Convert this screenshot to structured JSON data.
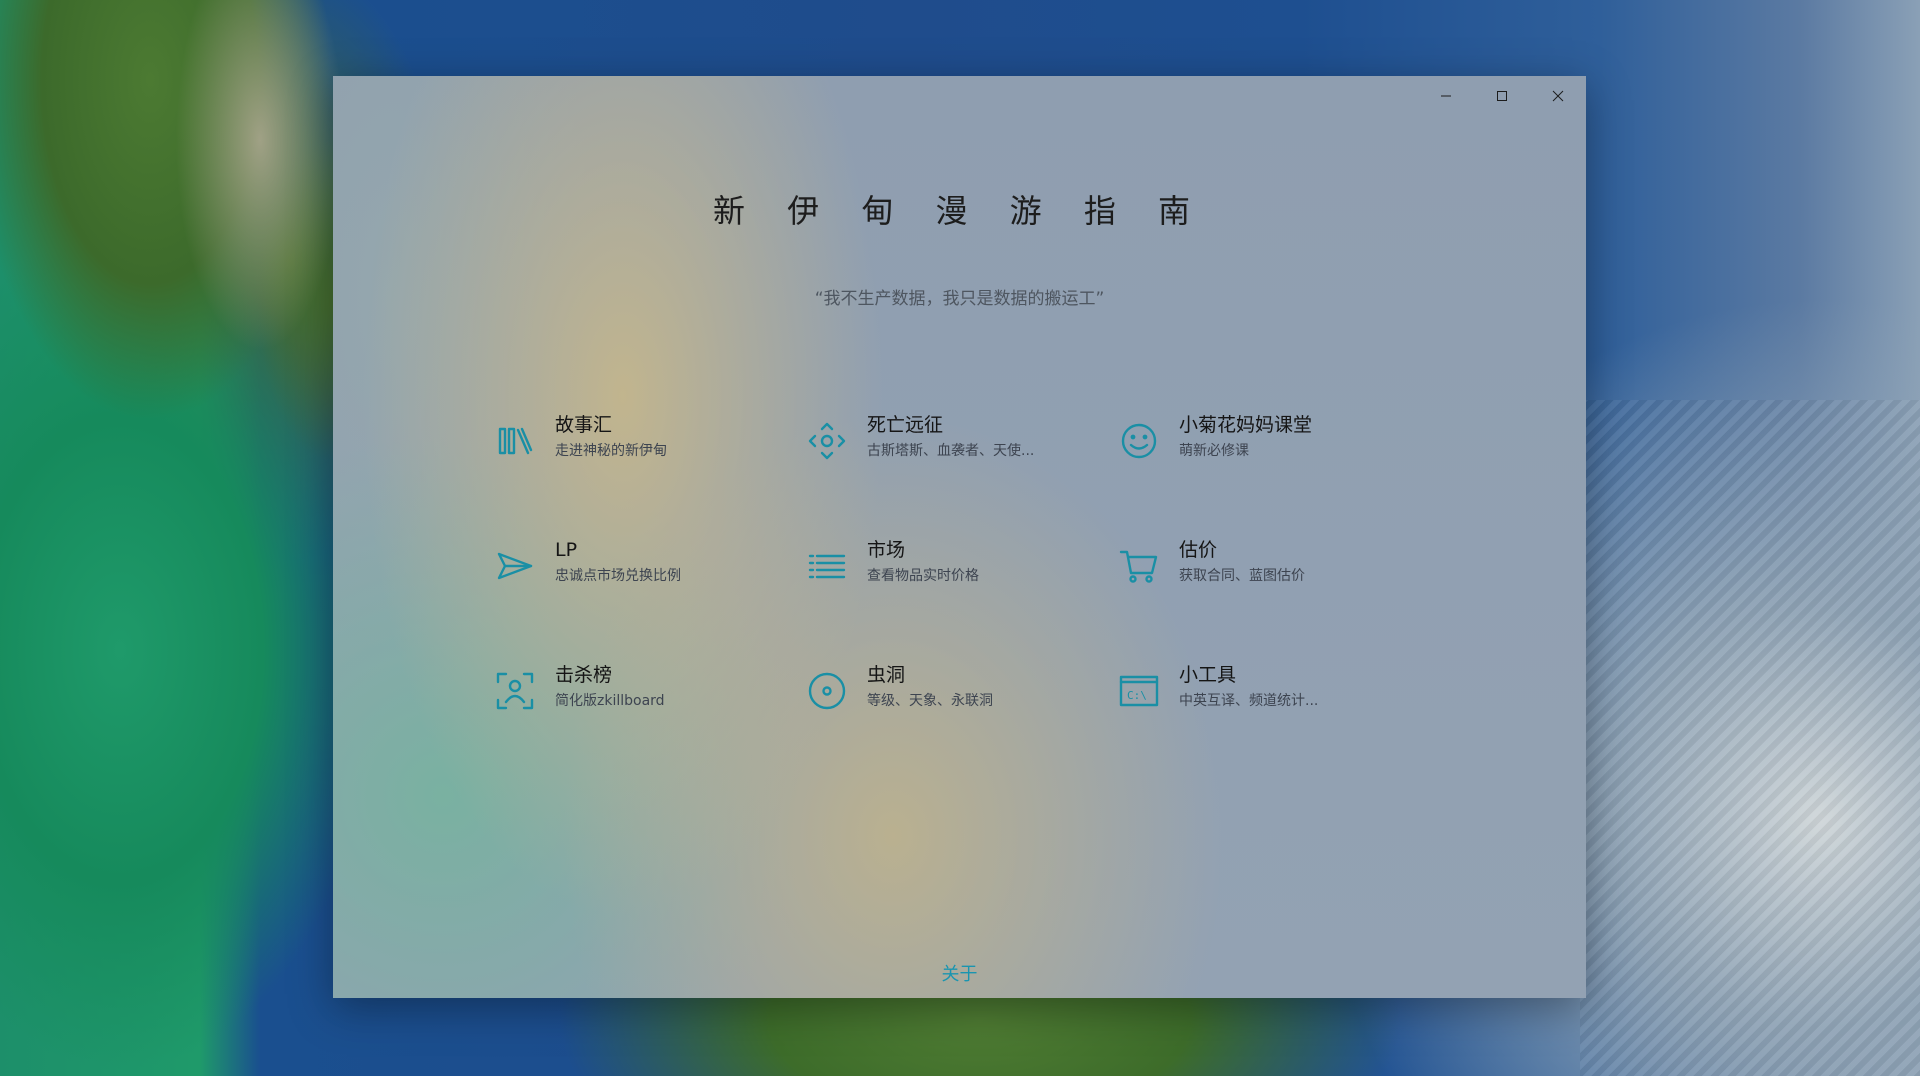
{
  "window": {
    "controls": {
      "minimize_icon": "minimize-icon",
      "maximize_icon": "maximize-icon",
      "close_icon": "close-icon"
    }
  },
  "header": {
    "title": "新 伊 甸 漫 游 指 南",
    "subtitle": "“我不生产数据，我只是数据的搬运工”"
  },
  "tiles": [
    {
      "icon": "library-icon",
      "title": "故事汇",
      "subtitle": "走进神秘的新伊甸"
    },
    {
      "icon": "move-arrows-icon",
      "title": "死亡远征",
      "subtitle": "古斯塔斯、血袭者、天使..."
    },
    {
      "icon": "smiley-icon",
      "title": "小菊花妈妈课堂",
      "subtitle": "萌新必修课"
    },
    {
      "icon": "send-icon",
      "title": "LP",
      "subtitle": "忠诚点市场兑换比例"
    },
    {
      "icon": "list-icon",
      "title": "市场",
      "subtitle": "查看物品实时价格"
    },
    {
      "icon": "cart-icon",
      "title": "估价",
      "subtitle": "获取合同、蓝图估价"
    },
    {
      "icon": "contact-scan-icon",
      "title": "击杀榜",
      "subtitle": "简化版zkillboard"
    },
    {
      "icon": "target-icon",
      "title": "虫洞",
      "subtitle": "等级、天象、永联洞"
    },
    {
      "icon": "command-prompt-icon",
      "title": "小工具",
      "subtitle": "中英互译、频道统计..."
    }
  ],
  "footer": {
    "about_label": "关于"
  },
  "colors": {
    "accent": "#1a8fa5",
    "title_text": "#1d1d1d",
    "subtitle_text": "#4e5660"
  }
}
